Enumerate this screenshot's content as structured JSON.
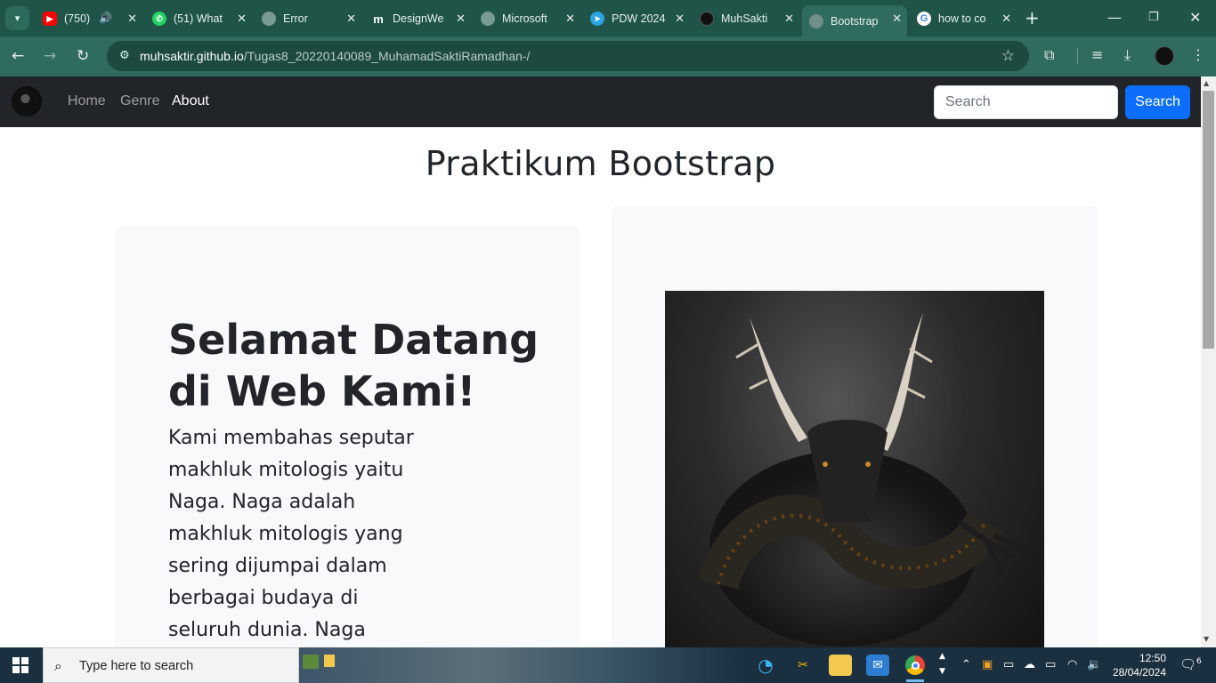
{
  "browser": {
    "tabs": [
      {
        "title": "(750)",
        "favicon": "youtube-icon",
        "color": "#ff0000",
        "audio": true
      },
      {
        "title": "(51) What",
        "favicon": "whatsapp-icon",
        "color": "#25d366"
      },
      {
        "title": "Error",
        "favicon": "globe-icon",
        "color": "#8aa"
      },
      {
        "title": "DesignWe",
        "favicon": "designweb-icon",
        "color": "#222"
      },
      {
        "title": "Microsoft",
        "favicon": "globe-icon",
        "color": "#8aa"
      },
      {
        "title": "PDW 2024",
        "favicon": "telegram-icon",
        "color": "#2aa3e0"
      },
      {
        "title": "MuhSakti",
        "favicon": "github-icon",
        "color": "#111"
      },
      {
        "title": "Bootstrap",
        "favicon": "globe-icon",
        "color": "#8aa",
        "active": true
      },
      {
        "title": "how to co",
        "favicon": "google-icon",
        "color": "#fff"
      }
    ],
    "url_host": "muhsaktir.github.io",
    "url_path": "/Tugas8_20220140089_MuhamadSaktiRamadhan-/"
  },
  "navbar": {
    "links": [
      "Home",
      "Genre",
      "About"
    ],
    "active": "About",
    "search_placeholder": "Search",
    "search_button": "Search"
  },
  "hero": {
    "page_title": "Praktikum Bootstrap",
    "heading": "Selamat Datang di Web Kami!",
    "text": "Kami membahas seputar makhluk mitologis yaitu Naga. Naga adalah makhluk mitologis yang sering dijumpai dalam berbagai budaya di seluruh dunia. Naga"
  },
  "taskbar": {
    "search_placeholder": "Type here to search",
    "time": "12:50",
    "date": "28/04/2024",
    "notifications": "6"
  }
}
